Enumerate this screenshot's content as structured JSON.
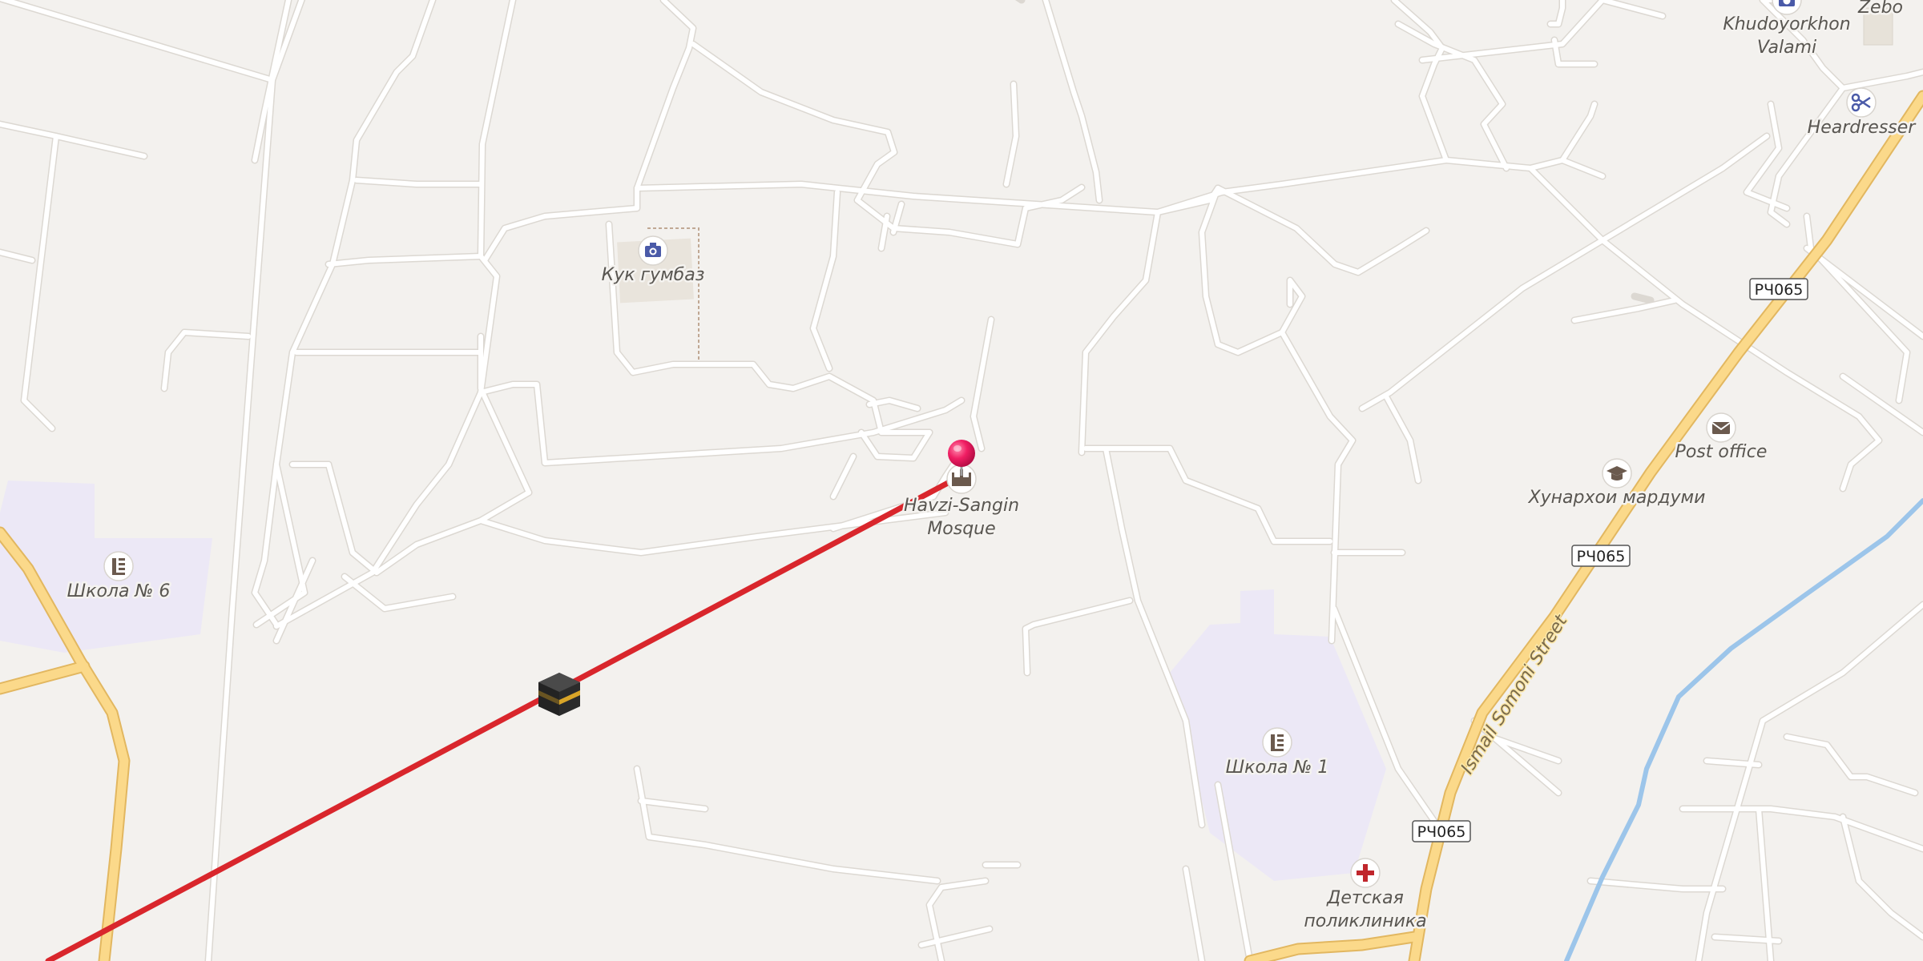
{
  "map": {
    "pois": [
      {
        "name": "Кук гумбаз",
        "icon": "camera-icon",
        "type": "attraction"
      },
      {
        "name": "Хавзи-Сангин Mosque",
        "name_lines": [
          "Havzi-Sangin",
          "Mosque"
        ],
        "icon": "mosque-icon",
        "type": "worship"
      },
      {
        "name": "Школа № 6",
        "icon": "school-icon",
        "type": "school"
      },
      {
        "name": "Школа № 1",
        "icon": "school-icon",
        "type": "school"
      },
      {
        "name": "Детская поликлиника",
        "name_lines": [
          "Детская",
          "поликлиника"
        ],
        "icon": "medical-cross-icon",
        "type": "clinic"
      },
      {
        "name": "Хунархои мардуми",
        "icon": "graduation-cap-icon",
        "type": "education"
      },
      {
        "name": "Post office",
        "icon": "envelope-icon",
        "type": "post"
      },
      {
        "name": "Heardresser",
        "icon": "scissors-icon",
        "type": "hairdresser"
      },
      {
        "name": "Khudoyorkhon Valami",
        "name_lines": [
          "Khudoyorkhon",
          "Valami"
        ],
        "icon": "camera-icon",
        "type": "attraction"
      },
      {
        "name": "Zebo",
        "icon": "",
        "type": "place"
      }
    ],
    "road_shields": [
      "РЧ065",
      "РЧ065",
      "РЧ065"
    ],
    "street_name": "Ismail Somoni Street",
    "markers": {
      "location_pin": {
        "icon": "map-pin-icon",
        "color": "#e8175d"
      },
      "qibla": {
        "icon": "kaaba-icon"
      }
    },
    "qibla_line_color": "#d9262c",
    "colors": {
      "background": "#f3f1ee",
      "road": "#ffffff",
      "road_casing": "#dedad4",
      "major_road": "#fbd98a",
      "major_road_casing": "#e2b760",
      "school_area": "#ece8f6",
      "water": "#9cc5ea"
    }
  }
}
